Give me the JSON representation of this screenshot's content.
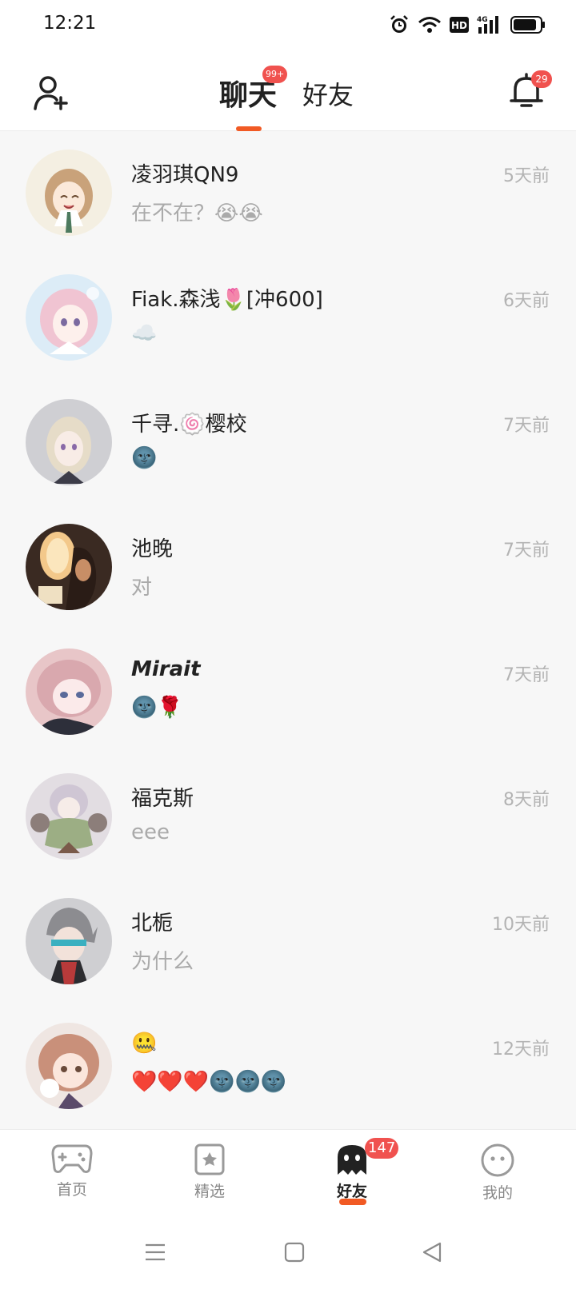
{
  "status": {
    "time": "12:21",
    "hd_label": "HD",
    "network_label": "4G",
    "icons": [
      "alarm-icon",
      "wifi-icon",
      "hd-icon",
      "signal-4g-icon",
      "battery-icon"
    ]
  },
  "header": {
    "tabs": [
      {
        "label": "聊天",
        "active": true,
        "badge": "99+"
      },
      {
        "label": "好友",
        "active": false
      }
    ],
    "bell_badge": "29",
    "accent_color": "#f15a24",
    "badge_color": "#f0524f"
  },
  "chats": [
    {
      "name": "凌羽琪QN9",
      "message": "在不在？😭😭",
      "time": "5天前"
    },
    {
      "name": "Fiak.森浅🌷[冲600]",
      "message": "☁️",
      "time": "6天前"
    },
    {
      "name": "千寻.🍥樱校",
      "message": "🌚",
      "time": "7天前"
    },
    {
      "name": "池晚",
      "message": "对",
      "time": "7天前"
    },
    {
      "name": "Mirait",
      "message": "🌚🌹",
      "time": "7天前"
    },
    {
      "name": "福克斯",
      "message": "eee",
      "time": "8天前"
    },
    {
      "name": "北栀",
      "message": "为什么",
      "time": "10天前"
    },
    {
      "name": "🤐",
      "message": "❤️❤️❤️🌚🌚🌚",
      "time": "12天前"
    }
  ],
  "bottom_nav": {
    "items": [
      {
        "label": "首页",
        "icon": "gamepad-icon",
        "active": false
      },
      {
        "label": "精选",
        "icon": "star-frame-icon",
        "active": false
      },
      {
        "label": "好友",
        "icon": "ghost-icon",
        "active": true,
        "badge": "147"
      },
      {
        "label": "我的",
        "icon": "face-icon",
        "active": false
      }
    ]
  },
  "system_nav": {
    "icons": [
      "menu-icon",
      "home-square-icon",
      "back-triangle-icon"
    ]
  }
}
